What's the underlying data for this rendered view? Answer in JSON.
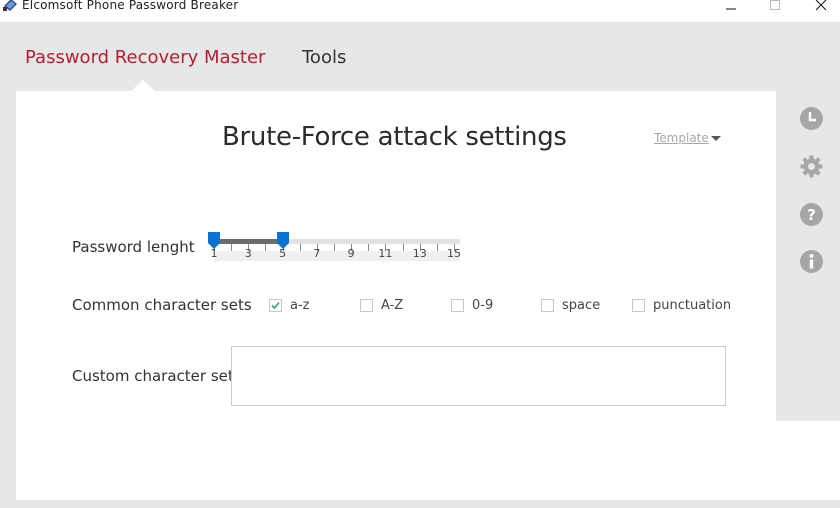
{
  "window": {
    "title": "Elcomsoft Phone Password Breaker",
    "controls": [
      "minimize",
      "maximize",
      "close"
    ]
  },
  "nav": {
    "tabs": [
      {
        "label": "Password Recovery Master",
        "active": true
      },
      {
        "label": "Tools",
        "active": false
      }
    ],
    "accent_color": "#b51e2d"
  },
  "main": {
    "title": "Brute-Force attack settings",
    "template_label": "Template",
    "password_length": {
      "label": "Password lenght",
      "min": 1,
      "max": 15,
      "selected_min": 1,
      "selected_max": 5,
      "tick_labels": [
        "1",
        "3",
        "5",
        "7",
        "9",
        "11",
        "13",
        "15"
      ],
      "handle_color": "#0a72cf"
    },
    "charsets": {
      "label": "Common character sets",
      "options": [
        {
          "label": "a-z",
          "checked": true
        },
        {
          "label": "A-Z",
          "checked": false
        },
        {
          "label": "0-9",
          "checked": false
        },
        {
          "label": "space",
          "checked": false
        },
        {
          "label": "punctuation",
          "checked": false
        }
      ]
    },
    "custom_charset": {
      "label": "Custom character set",
      "value": "",
      "placeholder": ""
    }
  },
  "sidebar": {
    "icons": [
      "history-icon",
      "settings-icon",
      "help-icon",
      "info-icon"
    ]
  }
}
